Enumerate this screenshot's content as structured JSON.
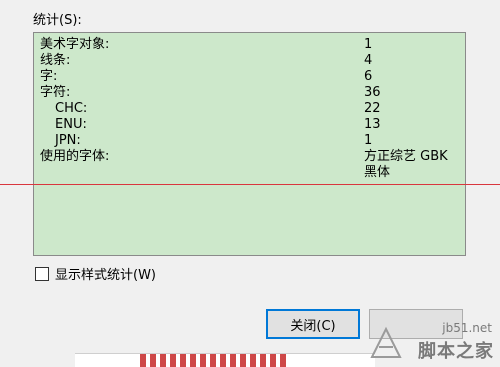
{
  "stats_label": "统计(S):",
  "rows": [
    {
      "label": "美术字对象:",
      "value": "1"
    },
    {
      "label": "线条:",
      "value": "4"
    },
    {
      "label": "字:",
      "value": "6"
    },
    {
      "label": "字符:",
      "value": "36"
    },
    {
      "label": "CHC:",
      "value": "22"
    },
    {
      "label": "ENU:",
      "value": "13"
    },
    {
      "label": "JPN:",
      "value": "1"
    },
    {
      "label": "使用的字体:",
      "value_lines": [
        "方正综艺 GBK",
        "黑体"
      ]
    }
  ],
  "checkbox": {
    "label": "显示样式统计(W)",
    "checked": false
  },
  "buttons": {
    "close": "关闭(C)"
  },
  "watermark": {
    "site": "jb51.net",
    "brand": "脚本之家"
  },
  "colors": {
    "panel_bg": "#cde8cb",
    "guide_line": "#d9363e",
    "focus_border": "#0078d7"
  }
}
